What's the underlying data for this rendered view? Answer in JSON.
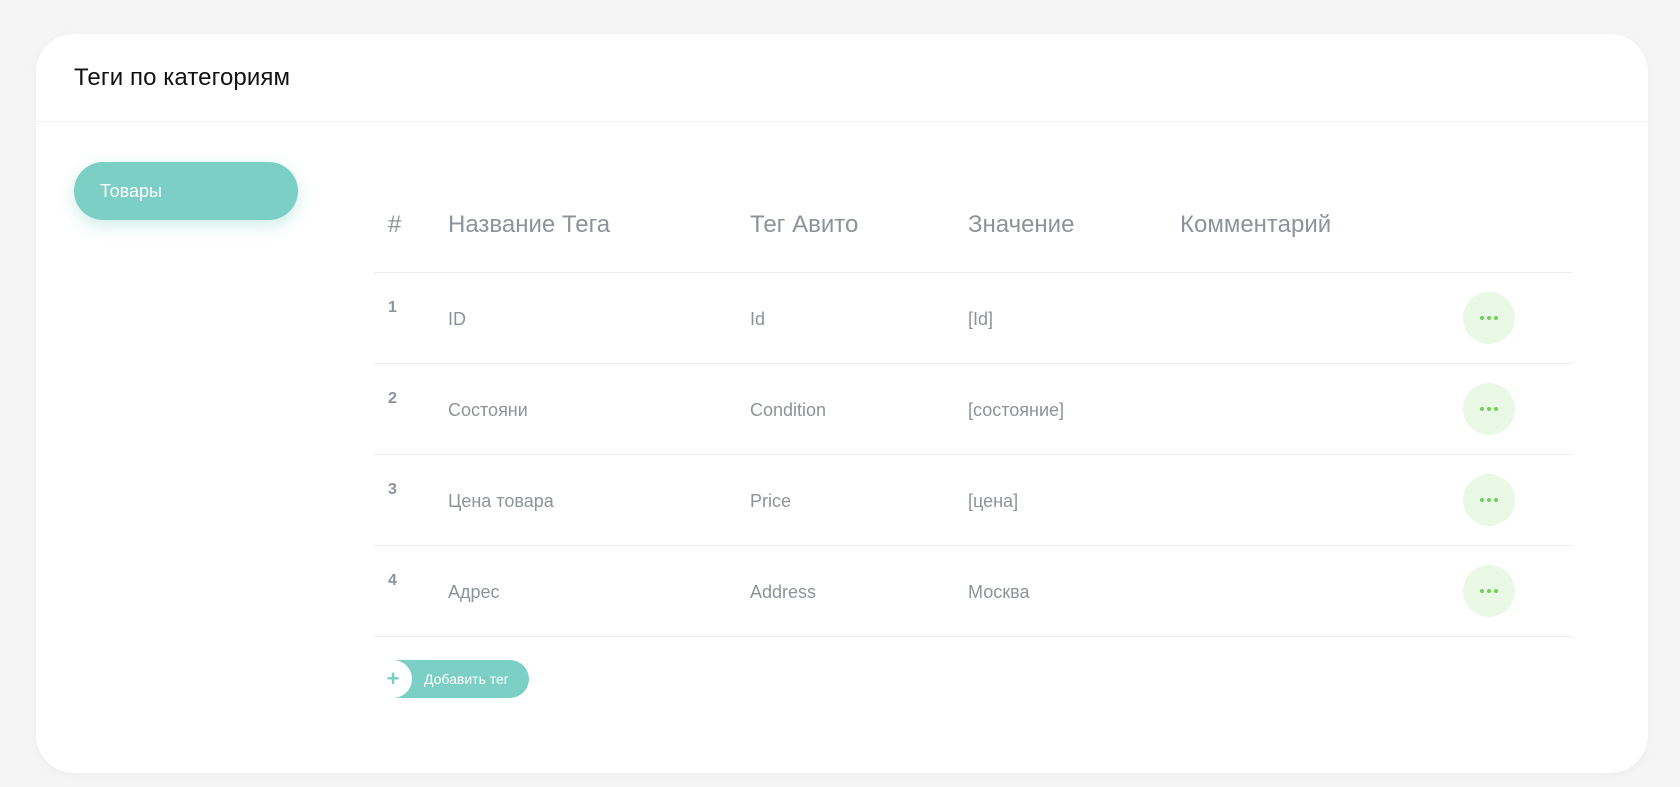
{
  "header": {
    "title": "Теги по категориям"
  },
  "categories": [
    {
      "label": "Товары",
      "active": true
    }
  ],
  "table": {
    "headers": [
      "#",
      "Название Тега",
      "Тег Авито",
      "Значение",
      "Комментарий"
    ],
    "rows": [
      {
        "num": "1",
        "name": "ID",
        "avito_tag": "Id",
        "value": "[Id]",
        "comment": ""
      },
      {
        "num": "2",
        "name": "Состояни",
        "avito_tag": "Condition",
        "value": "[состояние]",
        "comment": ""
      },
      {
        "num": "3",
        "name": "Цена товара",
        "avito_tag": "Price",
        "value": "[цена]",
        "comment": ""
      },
      {
        "num": "4",
        "name": "Адрес",
        "avito_tag": "Address",
        "value": "Москва",
        "comment": ""
      }
    ]
  },
  "actions": {
    "add_plus": "+",
    "add_label": "Добавить тег"
  },
  "colors": {
    "accent": "#7ccfc4",
    "more_bg": "#eaf8e6",
    "more_dots": "#6fd05a",
    "text_muted": "#8e9299"
  },
  "icons": {
    "row_menu": "more-horizontal-icon",
    "add": "plus-icon"
  }
}
